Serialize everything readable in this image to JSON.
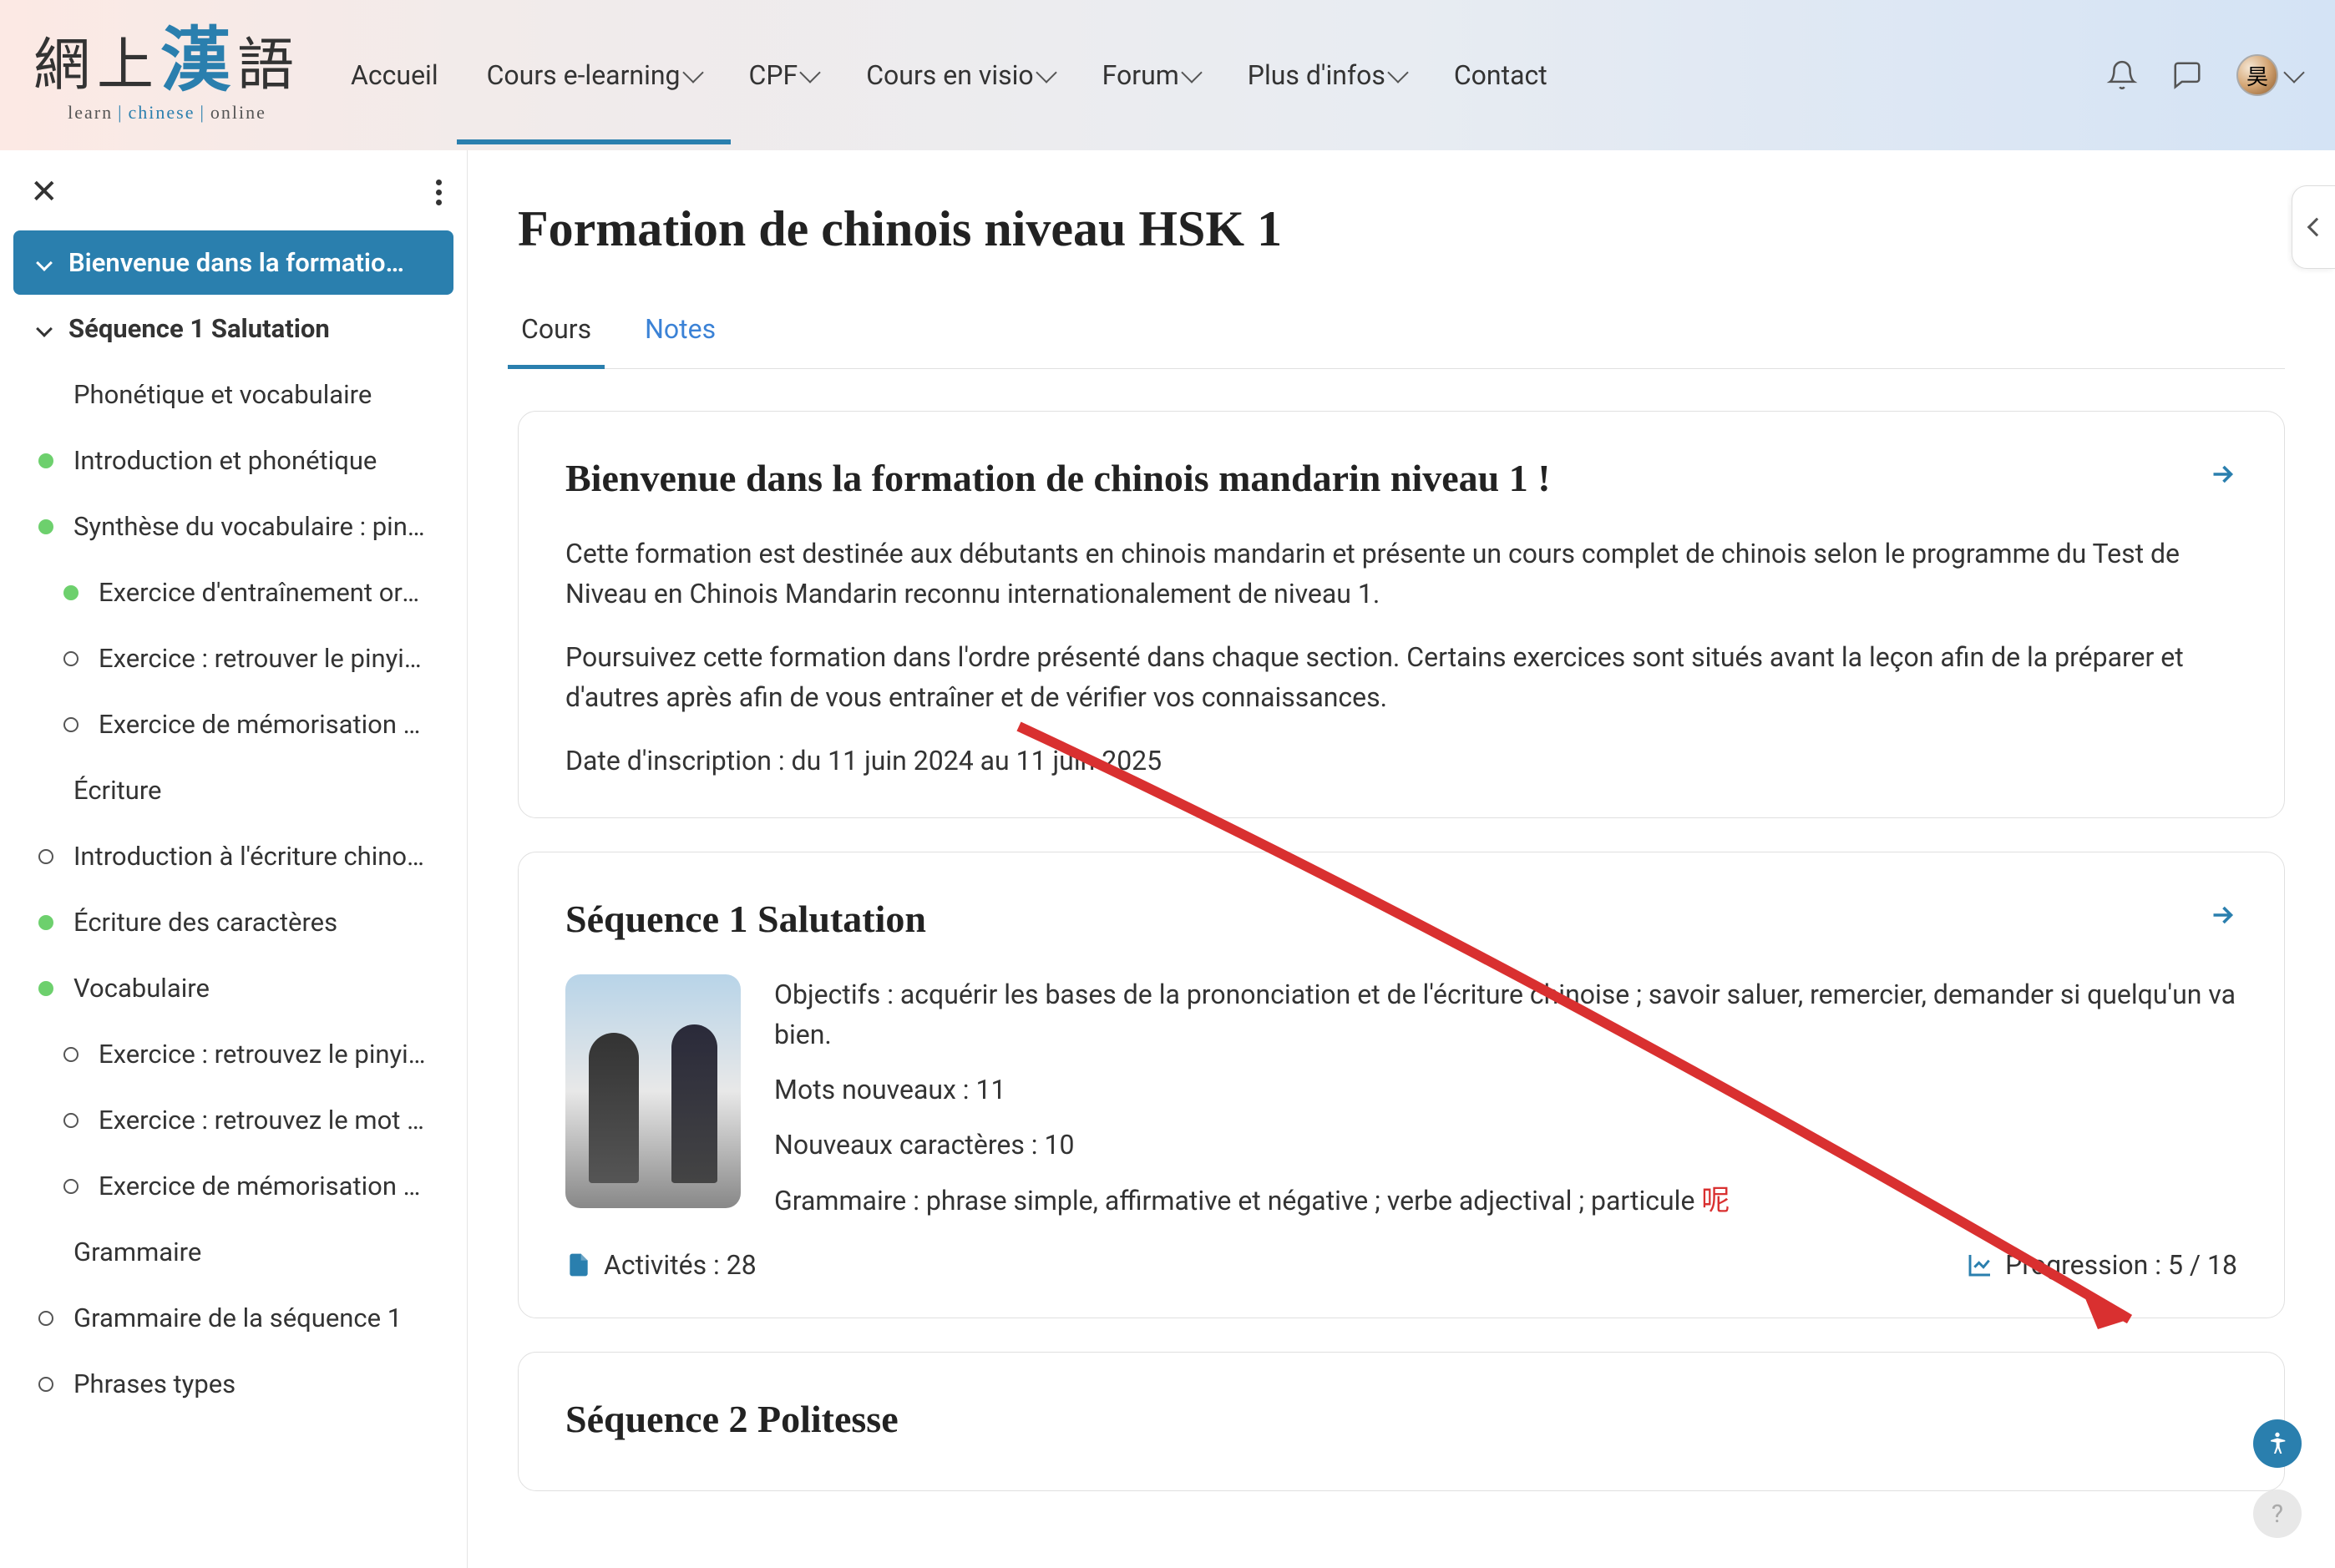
{
  "nav": {
    "items": [
      {
        "label": "Accueil",
        "dropdown": false
      },
      {
        "label": "Cours e-learning",
        "dropdown": true,
        "active": true
      },
      {
        "label": "CPF",
        "dropdown": true
      },
      {
        "label": "Cours en visio",
        "dropdown": true
      },
      {
        "label": "Forum",
        "dropdown": true
      },
      {
        "label": "Plus d'infos",
        "dropdown": true
      },
      {
        "label": "Contact",
        "dropdown": false
      }
    ]
  },
  "logo": {
    "cn_l": "網上",
    "cn_r": "語",
    "accent": "漢",
    "sub_l": "learn",
    "sub_m": "chinese",
    "sub_r": "online"
  },
  "sidebar": {
    "items": [
      {
        "label": "Bienvenue dans la formatio…",
        "type": "chev",
        "level": 1,
        "selected": true
      },
      {
        "label": "Séquence 1 Salutation",
        "type": "chev",
        "level": 1,
        "bold": true
      },
      {
        "label": "Phonétique et vocabulaire",
        "type": "none",
        "level": 2
      },
      {
        "label": "Introduction et phonétique",
        "type": "green",
        "level": 2
      },
      {
        "label": "Synthèse du vocabulaire : pinyi…",
        "type": "green",
        "level": 2
      },
      {
        "label": "Exercice d'entraînement oral …",
        "type": "green",
        "level": 3
      },
      {
        "label": "Exercice : retrouver le pinyin …",
        "type": "empty",
        "level": 3
      },
      {
        "label": "Exercice de mémorisation du…",
        "type": "empty",
        "level": 3
      },
      {
        "label": "Écriture",
        "type": "none",
        "level": 2
      },
      {
        "label": "Introduction à l'écriture chinoise",
        "type": "empty",
        "level": 2
      },
      {
        "label": "Écriture des caractères",
        "type": "green",
        "level": 2
      },
      {
        "label": "Vocabulaire",
        "type": "green",
        "level": 2
      },
      {
        "label": "Exercice : retrouvez le pinyin …",
        "type": "empty",
        "level": 3
      },
      {
        "label": "Exercice : retrouvez le mot c…",
        "type": "empty",
        "level": 3
      },
      {
        "label": "Exercice de mémorisation du…",
        "type": "empty",
        "level": 3
      },
      {
        "label": "Grammaire",
        "type": "none",
        "level": 2
      },
      {
        "label": "Grammaire de la séquence 1",
        "type": "empty",
        "level": 2
      },
      {
        "label": "Phrases types",
        "type": "empty",
        "level": 2
      }
    ]
  },
  "page": {
    "title": "Formation de chinois niveau HSK 1",
    "tabs": [
      {
        "label": "Cours",
        "active": true
      },
      {
        "label": "Notes",
        "active": false
      }
    ]
  },
  "card1": {
    "title": "Bienvenue dans la formation de chinois mandarin niveau 1 !",
    "p1": "Cette formation est destinée aux débutants en chinois mandarin et présente un cours complet de chinois selon le programme du Test de Niveau en Chinois Mandarin reconnu internationalement de niveau 1.",
    "p2": "Poursuivez cette formation dans l'ordre présenté dans chaque section. Certains exercices sont situés avant la leçon afin de la préparer et d'autres après afin de vous entraîner et de vérifier vos connaissances.",
    "p3": "Date d'inscription : du 11 juin 2024 au 11 juin 2025"
  },
  "card2": {
    "title": "Séquence 1 Salutation",
    "obj": "Objectifs : acquérir les bases de la prononciation et de l'écriture chinoise ; savoir saluer, remercier, demander si quelqu'un va bien.",
    "mots": "Mots nouveaux : 11",
    "carac": "Nouveaux caractères : 10",
    "gram_pre": "Grammaire : phrase simple, affirmative et négative ; verbe adjectival ; particule ",
    "gram_cn": "呢",
    "activites": "Activités : 28",
    "progress": "Progression : 5 / 18"
  },
  "card3": {
    "title": "Séquence 2 Politesse"
  }
}
